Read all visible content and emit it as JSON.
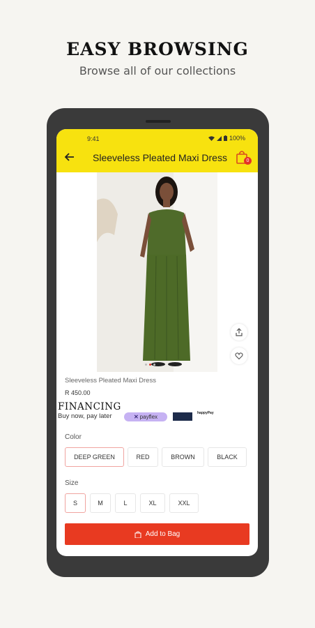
{
  "promo": {
    "title": "EASY BROWSING",
    "subtitle": "Browse all of our collections"
  },
  "status_bar": {
    "time": "9:41",
    "battery": "100%"
  },
  "app_bar": {
    "title": "Sleeveless Pleated Maxi Dress",
    "bag_count": "0",
    "color": "#f7e20f"
  },
  "product": {
    "name": "Sleeveless Pleated Maxi Dress",
    "price": "R 450.00",
    "image_dots": 3,
    "active_dot": 1
  },
  "financing": {
    "title": "FINANCING",
    "subtitle": "Buy now, pay later",
    "payflex": "payflex",
    "logo3": "happyPay"
  },
  "color_section": {
    "label": "Color",
    "options": [
      "DEEP GREEN",
      "RED",
      "BROWN",
      "BLACK"
    ],
    "selected": "DEEP GREEN"
  },
  "size_section": {
    "label": "Size",
    "options": [
      "S",
      "M",
      "L",
      "XL",
      "XXL"
    ],
    "selected": "S"
  },
  "cta": {
    "label": "Add to Bag",
    "color": "#e83a21"
  },
  "icons": [
    "back-arrow-icon",
    "bag-icon",
    "share-icon",
    "heart-icon",
    "payflex-logo-icon"
  ]
}
